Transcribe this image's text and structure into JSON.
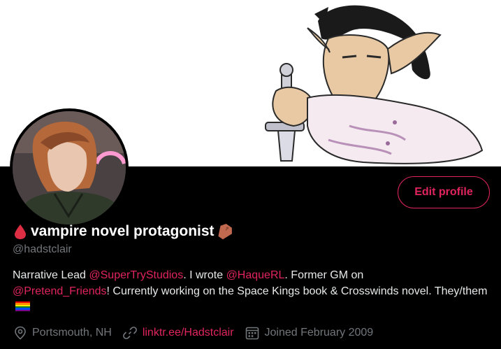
{
  "profile": {
    "display_name": "vampire novel protagonist",
    "handle": "@hadstclair",
    "edit_button": "Edit profile"
  },
  "bio": {
    "part1": "Narrative Lead ",
    "mention1": "@SuperTryStudios",
    "part2": ". I wrote ",
    "mention2": "@HaqueRL",
    "part3": ". Former GM on ",
    "mention3": "@Pretend_Friends",
    "part4": "! Currently working on the Space Kings book & Crosswinds novel. They/them"
  },
  "meta": {
    "location": "Portsmouth, NH",
    "link": "linktr.ee/Hadstclair",
    "joined": "Joined February 2009"
  },
  "colors": {
    "accent": "#e0245e",
    "background": "#000000",
    "secondary_text": "#71767b"
  },
  "icons": [
    "blood-drop-icon",
    "coffin-icon",
    "rainbow-flag-icon",
    "location-pin-icon",
    "link-icon",
    "calendar-icon"
  ]
}
